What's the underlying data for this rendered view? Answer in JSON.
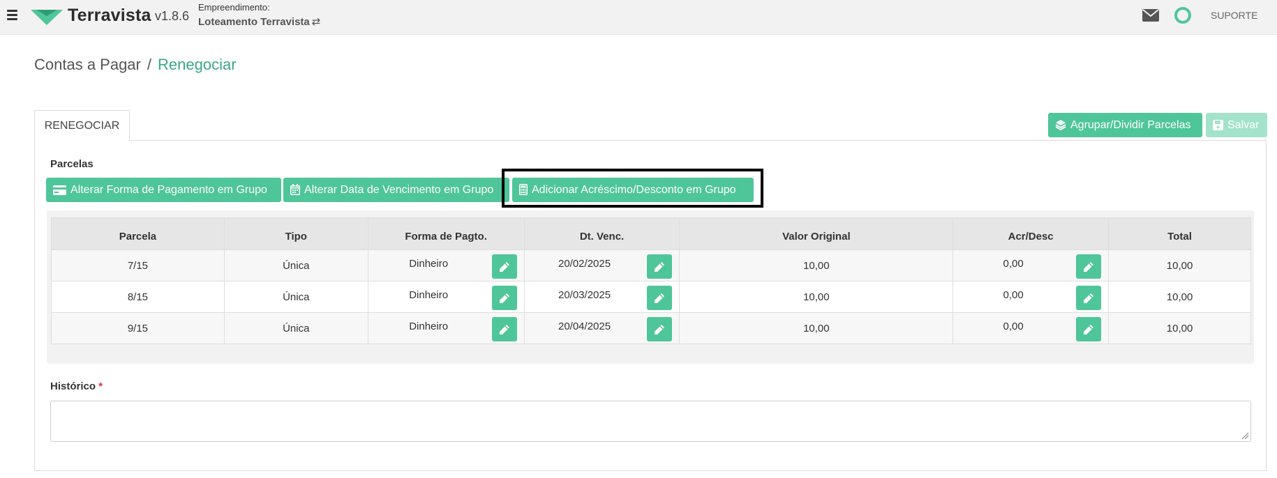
{
  "navbar": {
    "brand": "Terravista",
    "version": "v1.8.6",
    "empreendimento_label": "Empreendimento:",
    "empreendimento_name": "Loteamento Terravista",
    "swap_glyph": "⇄",
    "support": "SUPORTE"
  },
  "breadcrumb": {
    "parent": "Contas a Pagar",
    "separator": "/",
    "current": "Renegociar"
  },
  "tab": {
    "label": "RENEGOCIAR"
  },
  "actions": {
    "group_split": "Agrupar/Dividir Parcelas",
    "save": "Salvar"
  },
  "parcelas": {
    "label": "Parcelas",
    "btn_forma": "Alterar Forma de Pagamento em Grupo",
    "btn_data": "Alterar Data de Vencimento em Grupo",
    "btn_acres": "Adicionar Acréscimo/Desconto em Grupo"
  },
  "table": {
    "headers": [
      "Parcela",
      "Tipo",
      "Forma de Pagto.",
      "Dt. Venc.",
      "Valor Original",
      "Acr/Desc",
      "Total"
    ],
    "rows": [
      {
        "parcela": "7/15",
        "tipo": "Única",
        "forma": "Dinheiro",
        "venc": "20/02/2025",
        "valor": "10,00",
        "acr": "0,00",
        "total": "10,00"
      },
      {
        "parcela": "8/15",
        "tipo": "Única",
        "forma": "Dinheiro",
        "venc": "20/03/2025",
        "valor": "10,00",
        "acr": "0,00",
        "total": "10,00"
      },
      {
        "parcela": "9/15",
        "tipo": "Única",
        "forma": "Dinheiro",
        "venc": "20/04/2025",
        "valor": "10,00",
        "acr": "0,00",
        "total": "10,00"
      }
    ]
  },
  "historico": {
    "label": "Histórico",
    "required_mark": "*",
    "value": ""
  },
  "colors": {
    "accent": "#4fc59a",
    "accent_light": "#a3e2cb",
    "breadcrumb_active": "#3aa882",
    "required": "#d9303a"
  }
}
